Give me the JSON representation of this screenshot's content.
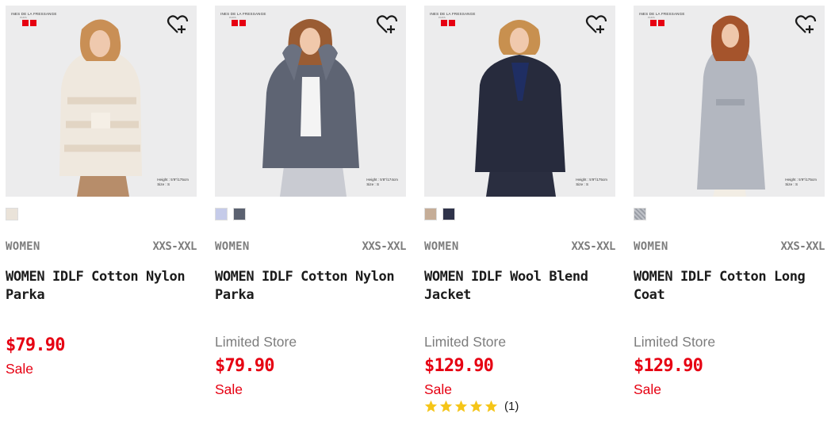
{
  "colors": {
    "sale_red": "#e60012",
    "muted_gray": "#7d7d7d",
    "star_gold": "#f5c518"
  },
  "products": [
    {
      "image": {
        "brand": "INES DE LA FRESSANGE",
        "brand_sub": "PARIS",
        "height_note": "Height : 5'9\"/175cm",
        "size_note": "Size : S",
        "bg": "#ededee"
      },
      "swatch_colors": [
        "#eae3d9"
      ],
      "gender": "WOMEN",
      "size_range": "XXS-XXL",
      "name_line1": "WOMEN IDLF Cotton Nylon",
      "name_line2": "Parka",
      "limited": "",
      "price": "$79.90",
      "sale": "Sale"
    },
    {
      "image": {
        "brand": "INES DE LA FRESSANGE",
        "brand_sub": "PARIS",
        "height_note": "Height : 5'8\"/174cm",
        "size_note": "Size : S",
        "bg": "#ededee"
      },
      "swatch_colors": [
        "#c5cbe9",
        "#5b6170"
      ],
      "gender": "WOMEN",
      "size_range": "XXS-XXL",
      "name_line1": "WOMEN IDLF Cotton Nylon",
      "name_line2": "Parka",
      "limited": "Limited Store",
      "price": "$79.90",
      "sale": "Sale"
    },
    {
      "image": {
        "brand": "INES DE LA FRESSANGE",
        "brand_sub": "PARIS",
        "height_note": "Height : 5'9\"/175cm",
        "size_note": "Size : S",
        "bg": "#ededee"
      },
      "swatch_colors": [
        "#c5ad97",
        "#2f334a"
      ],
      "gender": "WOMEN",
      "size_range": "XXS-XXL",
      "name_line1": "WOMEN IDLF Wool Blend",
      "name_line2": "Jacket",
      "limited": "Limited Store",
      "price": "$129.90",
      "sale": "Sale",
      "rating": {
        "stars": 5,
        "count": "(1)"
      }
    },
    {
      "image": {
        "brand": "INES DE LA FRESSANGE",
        "brand_sub": "PARIS",
        "height_note": "Height : 5'9\"/175cm",
        "size_note": "Size : S",
        "bg": "#ededee"
      },
      "swatch_colors": [
        "#a9acb3"
      ],
      "gender": "WOMEN",
      "size_range": "XXS-XXL",
      "name_line1": "WOMEN IDLF Cotton Long",
      "name_line2": "Coat",
      "limited": "Limited Store",
      "price": "$129.90",
      "sale": "Sale"
    }
  ]
}
